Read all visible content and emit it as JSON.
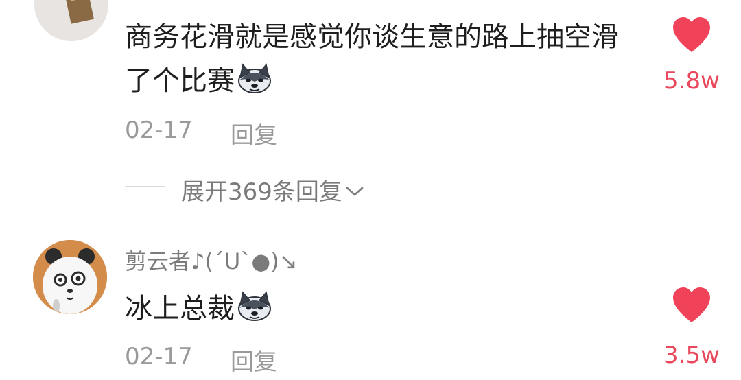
{
  "comments": [
    {
      "username": "",
      "text": "商务花滑就是感觉你谈生意的路上抽空滑了个比赛",
      "emoji": "husky-emoji",
      "date": "02-17",
      "reply_label": "回复",
      "likes": "5.8w",
      "expand_replies_label": "展开369条回复"
    },
    {
      "username": "剪云者♪(´U`●)↘",
      "text": "冰上总裁",
      "emoji": "husky-emoji",
      "date": "02-17",
      "reply_label": "回复",
      "likes": "3.5w"
    }
  ],
  "colors": {
    "like": "#e9475b",
    "muted_text": "#9a9a9a",
    "username": "#7b7b7b",
    "body_text": "#1e1e1e"
  },
  "icons": {
    "like": "heart-icon",
    "expand": "chevron-down-icon",
    "emoji": "husky-emoji"
  }
}
